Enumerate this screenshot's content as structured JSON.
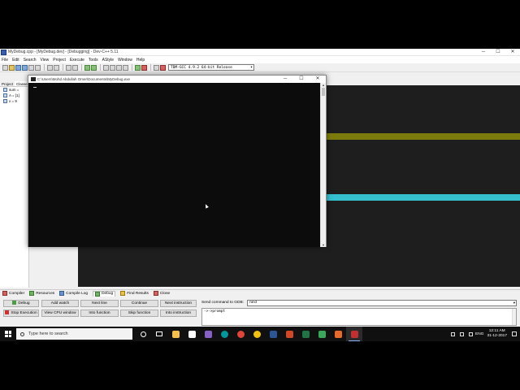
{
  "window": {
    "title": "MyDebug.cpp - [MyDebug.dev] - [Debugging] - Dev-C++ 5.11",
    "controls": [
      "─",
      "☐",
      "✕"
    ]
  },
  "menu": [
    "File",
    "Edit",
    "Search",
    "View",
    "Project",
    "Execute",
    "Tools",
    "AStyle",
    "Window",
    "Help"
  ],
  "toolbar": {
    "compiler": "TDM-GCC 4.9.2 64-bit Release",
    "dropdown_glyph": "▾"
  },
  "left_panel": {
    "tabs": [
      "Project",
      "Classes"
    ],
    "watches": [
      "sum = ",
      "A = [1]",
      "x = 9"
    ]
  },
  "console": {
    "title": "C:\\Users\\Mohd Abdullah Omer\\Documents\\MyDebug.exe",
    "controls": [
      "─",
      "☐",
      "✕"
    ],
    "scroll_up": "▲",
    "scroll_down": "▼"
  },
  "bottom_tabs": [
    "Compiler",
    "Resources",
    "Compile Log",
    "Debug",
    "Find Results",
    "Close"
  ],
  "debug": {
    "buttons_row1": [
      "Debug",
      "Add watch",
      "Next line",
      "Continue",
      "Next instruction"
    ],
    "buttons_row2": [
      "Stop Execution",
      "View CPU window",
      "Into function",
      "Skip function",
      "Into instruction"
    ],
    "gdb_label": "Send command to GDB:",
    "gdb_command": "next",
    "gdb_output": "->->prompt"
  },
  "taskbar": {
    "search_placeholder": "Type here to search",
    "language": "ENG",
    "time": "12:11 AM",
    "date": "31-12-2017"
  },
  "colors": {
    "editor_bg": "#1e1e1e",
    "stripe_olive": "#7c7c0e",
    "stripe_cyan": "#35c0cf",
    "console_bg": "#0c0c0c",
    "taskbar_bg": "#101010"
  }
}
